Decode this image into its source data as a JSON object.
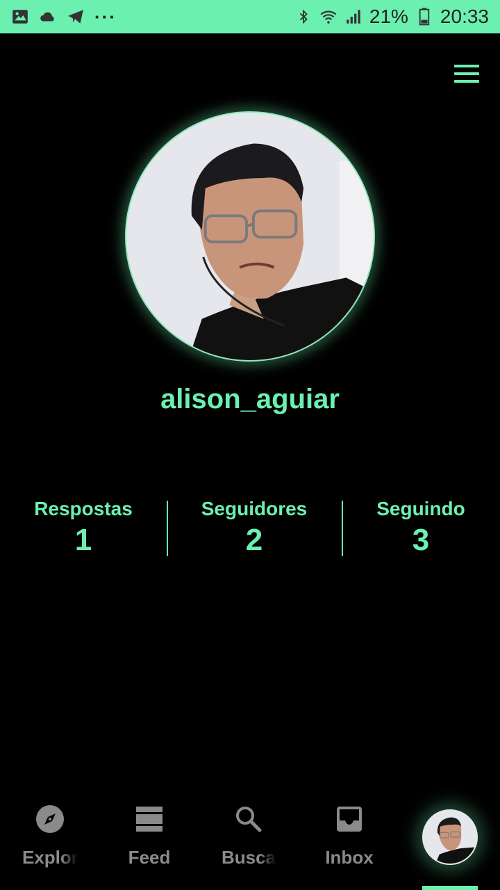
{
  "status_bar": {
    "left_icons": [
      "image-icon",
      "cloud-icon",
      "telegram-icon",
      "more-dots-icon"
    ],
    "more_dots": "···",
    "right_icons": [
      "bluetooth-icon",
      "wifi-icon",
      "signal-icon",
      "battery-icon"
    ],
    "battery": "21%",
    "time": "20:33"
  },
  "header": {
    "menu_icon": "hamburger-menu-icon"
  },
  "profile": {
    "username": "alison_aguiar",
    "stats": [
      {
        "label": "Respostas",
        "value": "1"
      },
      {
        "label": "Seguidores",
        "value": "2"
      },
      {
        "label": "Seguindo",
        "value": "3"
      }
    ]
  },
  "bottom_nav": {
    "items": [
      {
        "label": "Explore",
        "icon": "compass-icon"
      },
      {
        "label": "Feed",
        "icon": "feed-icon"
      },
      {
        "label": "Busca",
        "icon": "search-icon"
      },
      {
        "label": "Inbox",
        "icon": "inbox-icon"
      }
    ],
    "active": "profile"
  },
  "colors": {
    "accent": "#6cf0b0",
    "background": "#000000",
    "inactive": "#8a8a8a"
  }
}
